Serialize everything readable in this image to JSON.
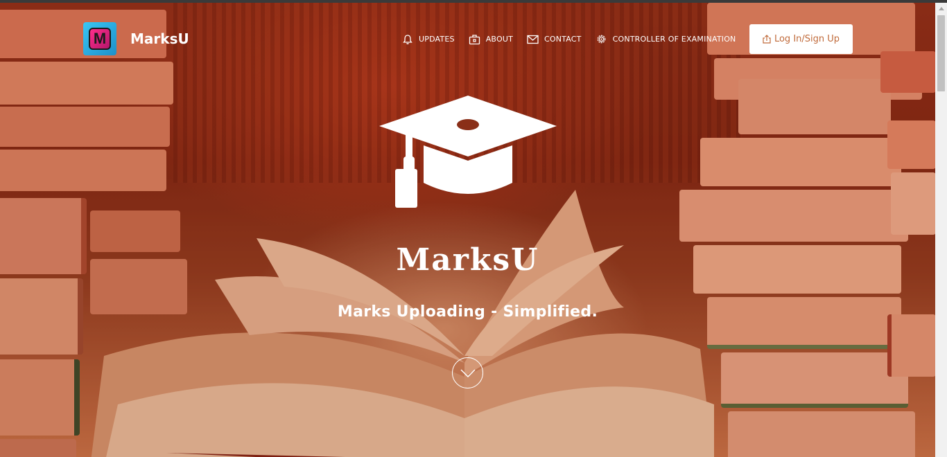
{
  "brand": {
    "name": "MarksU",
    "logo_letter": "M"
  },
  "nav": {
    "items": [
      {
        "label": "UPDATES",
        "icon": "bell-icon"
      },
      {
        "label": "ABOUT",
        "icon": "briefcase-icon"
      },
      {
        "label": "CONTACT",
        "icon": "envelope-icon"
      },
      {
        "label": "CONTROLLER OF EXAMINATION",
        "icon": "gear-icon"
      }
    ],
    "login_label": "Log In/Sign Up"
  },
  "hero": {
    "title": "MarksU",
    "tagline": "Marks Uploading - Simplified."
  },
  "colors": {
    "accent": "#c06a3a",
    "text": "#ffffff"
  }
}
